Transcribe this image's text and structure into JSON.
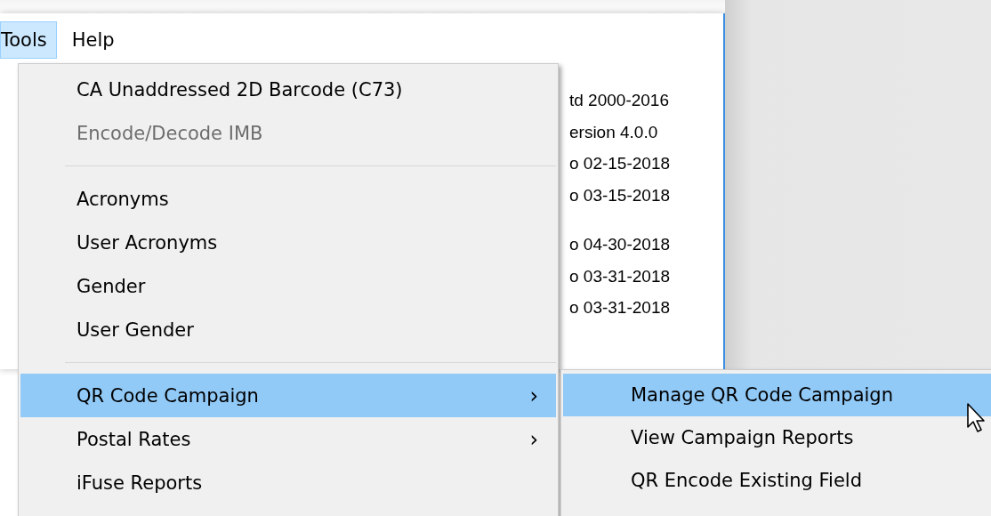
{
  "menubar": [
    {
      "label": "Tools",
      "selected": true
    },
    {
      "label": "Help",
      "selected": false
    }
  ],
  "background_text": [
    [
      "td 2000-2016",
      "ersion 4.0.0",
      "o 02-15-2018",
      "o 03-15-2018"
    ],
    [
      "o 04-30-2018",
      "o 03-31-2018",
      "o 03-31-2018"
    ]
  ],
  "menu": {
    "items": [
      {
        "kind": "item",
        "label": "CA Unaddressed 2D Barcode (C73)",
        "disabled": false,
        "selected": false
      },
      {
        "kind": "item",
        "label": "Encode/Decode IMB",
        "disabled": true,
        "selected": false
      },
      {
        "kind": "separator"
      },
      {
        "kind": "item",
        "label": "Acronyms",
        "disabled": false,
        "selected": false
      },
      {
        "kind": "item",
        "label": "User Acronyms",
        "disabled": false,
        "selected": false
      },
      {
        "kind": "item",
        "label": "Gender",
        "disabled": false,
        "selected": false
      },
      {
        "kind": "item",
        "label": "User Gender",
        "disabled": false,
        "selected": false
      },
      {
        "kind": "separator"
      },
      {
        "kind": "item",
        "label": "QR Code Campaign",
        "disabled": false,
        "selected": true,
        "arrow": "›"
      },
      {
        "kind": "item",
        "label": "Postal Rates",
        "disabled": false,
        "selected": false,
        "arrow": "›"
      },
      {
        "kind": "item",
        "label": "iFuse Reports",
        "disabled": false,
        "selected": false
      }
    ]
  },
  "submenu": {
    "items": [
      {
        "kind": "item",
        "label": "Manage QR Code Campaign",
        "disabled": false,
        "selected": true
      },
      {
        "kind": "item",
        "label": "View Campaign Reports",
        "disabled": false,
        "selected": false
      },
      {
        "kind": "item",
        "label": "QR Encode Existing Field",
        "disabled": false,
        "selected": false
      }
    ]
  }
}
